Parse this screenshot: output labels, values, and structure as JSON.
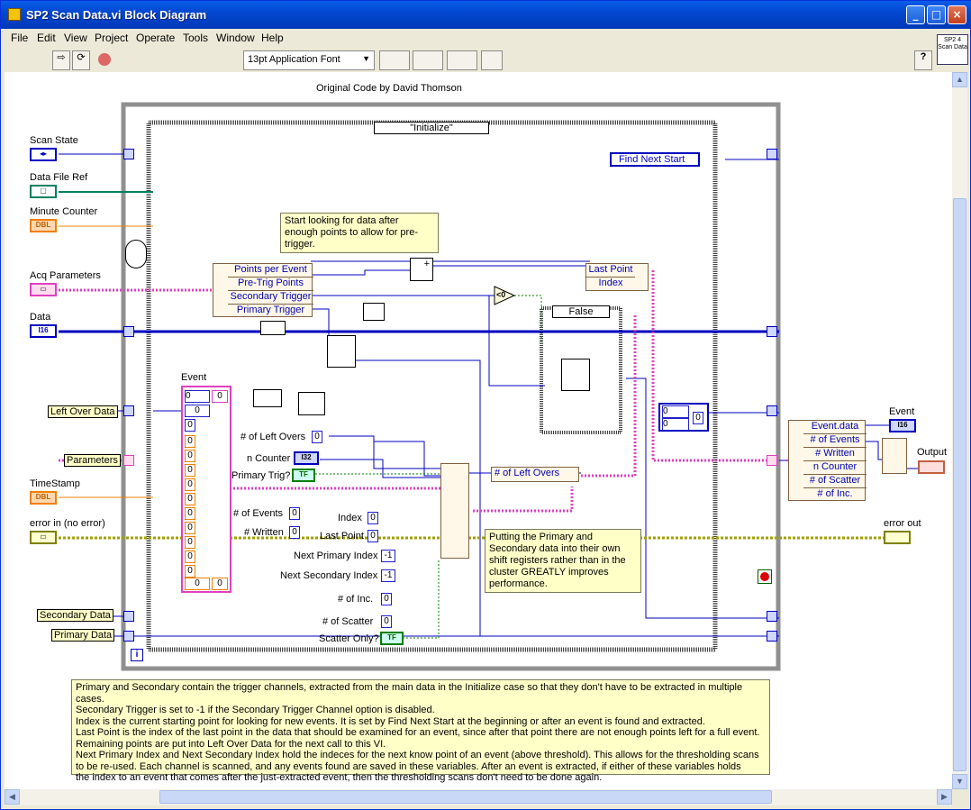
{
  "window": {
    "title": "SP2 Scan Data.vi Block Diagram",
    "minimize": "_",
    "maximize": "□",
    "close": "×"
  },
  "menu": [
    "File",
    "Edit",
    "View",
    "Project",
    "Operate",
    "Tools",
    "Window",
    "Help"
  ],
  "toolbar": {
    "font": "13pt Application Font",
    "font_dropdown": "▼",
    "vi_icon": "SP2 4 Scan Data",
    "help": "?"
  },
  "diagram": {
    "credit": "Original Code by David Thomson",
    "case_selector": "\"Initialize\"",
    "inner_case": "False",
    "enum_const": "Find Next Start",
    "inputs": [
      "Scan State",
      "Data File Ref",
      "Minute Counter",
      "Acq Parameters",
      "Data",
      "Left Over Data",
      "Parameters",
      "TimeStamp",
      "error in (no error)",
      "Secondary Data",
      "Primary Data"
    ],
    "input_types": {
      "scan_state": "◂▸",
      "data_file": "▢",
      "minute": "DBL",
      "acq": "▭",
      "data": "I16",
      "timestamp": "DBL",
      "error": "▭"
    },
    "outputs": [
      "Event",
      "Output",
      "error out"
    ],
    "event_type": "I16",
    "unbundle": [
      "Points per Event",
      "Pre-Trig Points",
      "Secondary Trigger",
      "Primary Trigger"
    ],
    "bundle_small": [
      "Last Point",
      "Index"
    ],
    "event_cluster": [
      "Event.data",
      "# of Events",
      "# Written",
      "n Counter",
      "# of Scatter",
      "# of Inc."
    ],
    "mid_labels": [
      {
        "t": "# of Left Overs",
        "v": "0"
      },
      {
        "t": "n Counter",
        "v": "I32"
      },
      {
        "t": "Primary Trig?",
        "v": "TF"
      },
      {
        "t": "# of Events",
        "v": "0"
      },
      {
        "t": "# Written",
        "v": "0"
      },
      {
        "t": "Index",
        "v": "0"
      },
      {
        "t": "Last Point",
        "v": "0"
      },
      {
        "t": "Next Primary Index",
        "v": "-1"
      },
      {
        "t": "Next Secondary Index",
        "v": "-1"
      },
      {
        "t": "# of Inc.",
        "v": "0"
      },
      {
        "t": "# of Scatter",
        "v": "0"
      },
      {
        "t": "Scatter Only?",
        "v": "TF"
      }
    ],
    "left_overs_label": "# of Left Overs",
    "event_array_label": "Event",
    "event_array_index": "0",
    "event_array_values": [
      "0",
      "0",
      "0",
      "0",
      "0",
      "0",
      "0",
      "0",
      "0",
      "0",
      "0",
      "0",
      "0"
    ],
    "small_array": [
      "0",
      "0",
      "0"
    ],
    "compare": "<0",
    "plus": "+",
    "info": "i",
    "note_trigger": "Start looking for data after enough points to allow for pre-trigger.",
    "note_shift": "Putting the Primary and Secondary data into their own shift registers rather than in the cluster GREATLY improves performance.",
    "comment_lines": [
      "Primary and Secondary contain the trigger channels, extracted from the main data in the Initialize case so that they don't have to be extracted in multiple cases.",
      "Secondary Trigger is set to -1 if the Secondary Trigger Channel option is disabled.",
      "Index is the current starting point for looking for new events.  It is set by Find Next Start at the beginning or after an event is found and extracted.",
      "Last Point is the index of the last point in the data that should be examined for an event, since after that point there are not enough points left for a full event.",
      "   Remaining points are put into Left Over Data for the next call to this VI.",
      "Next Primary Index and Next Secondary Index hold the indeces for the next know point of an event (above threshold).  This allows for the thresholding scans",
      "   to be re-used.  Each channel is scanned, and any events found are saved in these variables.  After an event is extracted, if either of these variables holds",
      "   the index to an event that comes after the just-extracted event, then the thresholding scans don't need to be done again."
    ]
  },
  "colors": {
    "blue_wire": "#0000c0",
    "pink_wire": "#e040c0",
    "orange": "#f08000",
    "green": "#008060",
    "yellow": "#a0a000",
    "note": "#ffffc8"
  }
}
